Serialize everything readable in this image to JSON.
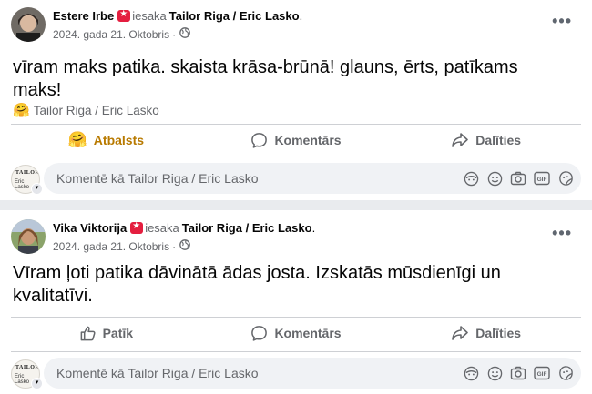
{
  "posts": [
    {
      "author": "Estere Irbe",
      "recommends_text": "iesaka",
      "page_name": "Tailor Riga / Eric Lasko",
      "page_suffix": ".",
      "date": "2024. gada 21. Oktobris",
      "dot": "·",
      "body_line1": "vīram maks patika. skaista krāsa-brūnā! glauns, ērts, patīkams",
      "body_line2": "maks!",
      "reaction_text": "Tailor Riga / Eric Lasko",
      "reaction_emoji": "🤗",
      "like_label": "Atbalsts",
      "like_emoji": "🤗",
      "comment_label": "Komentārs",
      "share_label": "Dalīties",
      "comment_placeholder": "Komentē kā Tailor Riga / Eric Lasko"
    },
    {
      "author": "Vika Viktorija",
      "recommends_text": "iesaka",
      "page_name": "Tailor Riga / Eric Lasko",
      "page_suffix": ".",
      "date": "2024. gada 21. Oktobris",
      "dot": "·",
      "body_line1": "Vīram ļoti patika dāvinātā ādas josta. Izskatās mūsdienīgi un",
      "body_line2": "kvalitatīvi.",
      "like_label": "Patīk",
      "comment_label": "Komentārs",
      "share_label": "Dalīties",
      "comment_placeholder": "Komentē kā Tailor Riga / Eric Lasko"
    }
  ],
  "more_label": "•••",
  "small_avatar": {
    "line1": "TAILOR",
    "line2": "Eric Lasko"
  },
  "comment_icons": [
    "avatar-sticker-icon",
    "emoji-icon",
    "camera-icon",
    "gif-icon",
    "sticker-icon"
  ],
  "gif_text": "GIF",
  "colors": {
    "support": "#b87a00",
    "badge": "#e41e3f",
    "muted": "#65676b"
  }
}
